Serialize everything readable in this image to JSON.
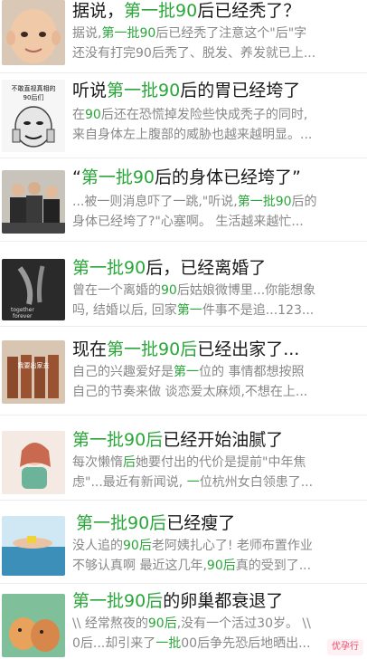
{
  "articles": [
    {
      "title": [
        "据说，",
        "第一批90",
        "后已经秃了？"
      ],
      "title_hl": [
        false,
        true,
        false
      ],
      "desc_line1": [
        "据说,",
        "第一批90",
        "后已经秃了注意这个\"后\"字"
      ],
      "desc_line1_hl": [
        false,
        true,
        false
      ],
      "desc_line2": [
        "还没有打完90后秃了、脱发、养发就已上..."
      ],
      "desc_line2_hl": [
        false
      ]
    },
    {
      "thumb_text": "不敢直视真相的90后们",
      "title": [
        "听说",
        "第一批90",
        "后的胃已经垮了"
      ],
      "title_hl": [
        false,
        true,
        false
      ],
      "desc_line1": [
        "在",
        "90",
        "后还在恐慌掉发险些快成秃子的同时,"
      ],
      "desc_line1_hl": [
        false,
        true,
        false
      ],
      "desc_line2": [
        "来自身体左上腹部的威胁也越来越明显。..."
      ],
      "desc_line2_hl": [
        false
      ]
    },
    {
      "title": [
        "“",
        "第一批90",
        "后的身体已经垮了”"
      ],
      "title_hl": [
        false,
        true,
        false
      ],
      "desc_line1": [
        "...被一则消息吓了一跳,\"听说,",
        "第一批90",
        "后的"
      ],
      "desc_line1_hl": [
        false,
        true,
        false
      ],
      "desc_line2": [
        "身体已经垮了?\"心塞啊。 生活越来越忙..."
      ],
      "desc_line2_hl": [
        false
      ]
    },
    {
      "thumb_text": "together forever",
      "title": [
        "第一批90",
        "后，已经离婚了"
      ],
      "title_hl": [
        true,
        false
      ],
      "desc_line1": [
        "曾在一个离婚的",
        "90",
        "后姑娘微博里...你能想象"
      ],
      "desc_line1_hl": [
        false,
        true,
        false
      ],
      "desc_line2": [
        "吗, 结婚以后, 回家",
        "第一",
        "件事不是追...123..."
      ],
      "desc_line2_hl": [
        false,
        true,
        false
      ]
    },
    {
      "thumb_text": "我要出家去",
      "title": [
        "现在",
        "第一批90后",
        "已经出家了..."
      ],
      "title_hl": [
        false,
        true,
        false
      ],
      "desc_line1": [
        "自己的兴趣爱好是",
        "第一",
        "位的 事情都想按照"
      ],
      "desc_line1_hl": [
        false,
        true,
        false
      ],
      "desc_line2": [
        "自己的节奏来做 谈恋爱太麻烦,不想在上..."
      ],
      "desc_line2_hl": [
        false
      ]
    },
    {
      "title": [
        "第一批90后",
        "已经开始油腻了"
      ],
      "title_hl": [
        true,
        false
      ],
      "desc_line1": [
        "每次懒惰",
        "后",
        "她要付出的代价是提前\"中年焦"
      ],
      "desc_line1_hl": [
        false,
        true,
        false
      ],
      "desc_line2": [
        "虑\"...最近有新闻说, ",
        "一",
        "位杭州女白领患了..."
      ],
      "desc_line2_hl": [
        false,
        true,
        false
      ]
    },
    {
      "title": [
        "第一批90后",
        "已经瘦了"
      ],
      "title_hl": [
        true,
        false
      ],
      "desc_line1": [
        "没人追的",
        "90后",
        "老阿姨扎心了! 老师布置作业"
      ],
      "desc_line1_hl": [
        false,
        true,
        false
      ],
      "desc_line2": [
        "不够认真啊 最近这几年,",
        "90后",
        "真的受到了..."
      ],
      "desc_line2_hl": [
        false,
        true,
        false
      ]
    },
    {
      "title": [
        "第一批90后",
        "的卵巢都衰退了"
      ],
      "title_hl": [
        true,
        false
      ],
      "desc_line1": [
        "\\\\ 经常熬夜的",
        "90后",
        ",没有一个活过30岁。 \\\\"
      ],
      "desc_line1_hl": [
        false,
        true,
        false
      ],
      "desc_line2": [
        "0后...却引来了",
        "一批",
        "00后争先恐后地晒出..."
      ],
      "desc_line2_hl": [
        false,
        true,
        false
      ]
    }
  ],
  "watermark": "优孕行",
  "colors": {
    "highlight": "#2aa63a",
    "text": "#1a1a1a",
    "muted": "#888888"
  }
}
